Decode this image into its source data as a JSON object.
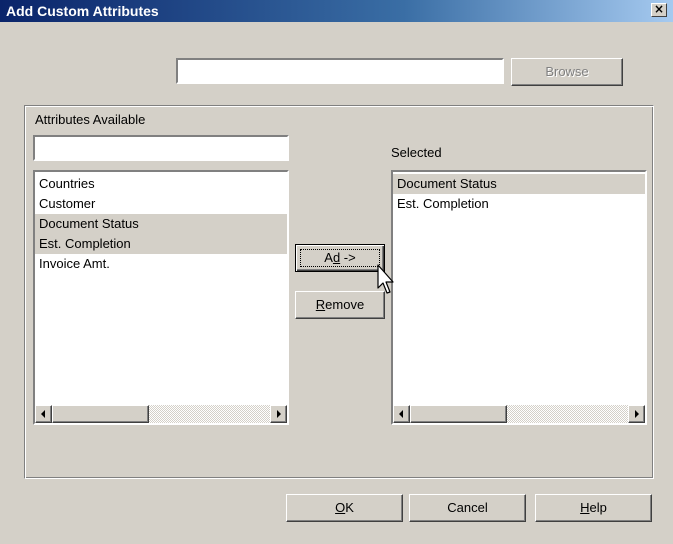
{
  "window": {
    "title": "Add Custom Attributes",
    "close_label": "×"
  },
  "top": {
    "path_value": "",
    "browse_label": "Browse"
  },
  "available": {
    "label": "Attributes Available",
    "filter_value": "",
    "items": [
      {
        "label": "Countries",
        "selected": false
      },
      {
        "label": "Customer",
        "selected": false
      },
      {
        "label": "Document Status",
        "selected": true
      },
      {
        "label": "Est. Completion",
        "selected": true
      },
      {
        "label": "Invoice Amt.",
        "selected": false
      }
    ]
  },
  "selected": {
    "label": "Selected",
    "items": [
      {
        "label": "Document Status",
        "selected": true
      },
      {
        "label": "Est. Completion",
        "selected": false
      }
    ]
  },
  "actions": {
    "add_prefix": "A",
    "add_underlined": "d",
    "add_suffix": "d ->",
    "remove_underlined": "R",
    "remove_suffix": "emove"
  },
  "footer": {
    "ok_underlined": "O",
    "ok_suffix": "K",
    "cancel_label": "Cancel",
    "help_underlined": "H",
    "help_suffix": "elp"
  },
  "icons": {
    "close": "close-icon",
    "scroll_left": "arrow-left-icon",
    "scroll_right": "arrow-right-icon",
    "cursor": "mouse-pointer-icon"
  },
  "colors": {
    "title_start": "#0a246a",
    "title_end": "#a6caf0",
    "face": "#d4d0c8",
    "selection": "#d4d0c8"
  }
}
